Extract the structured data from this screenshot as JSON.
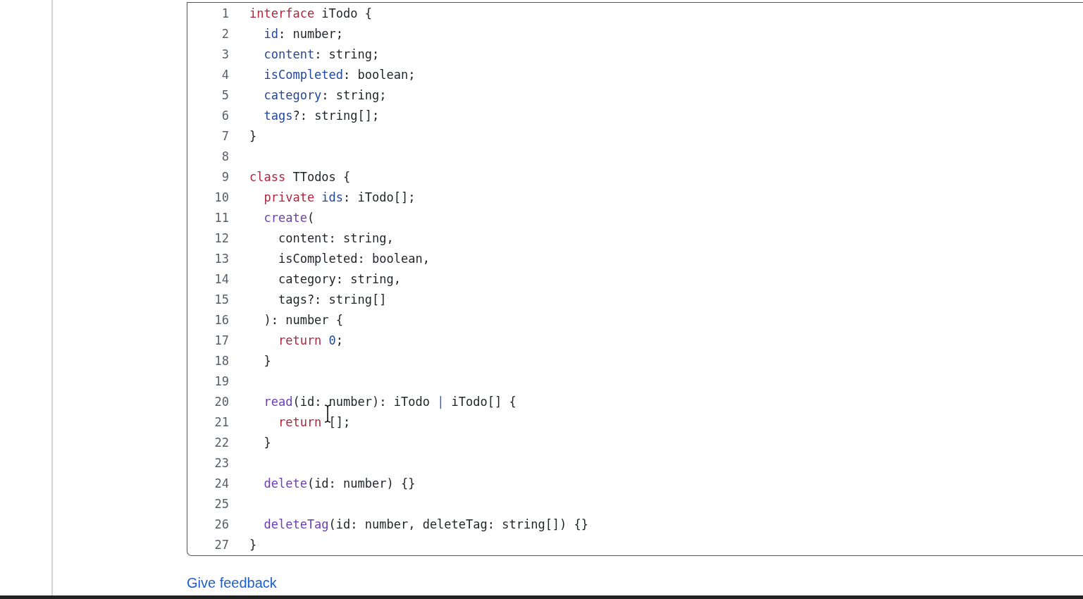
{
  "code_block": {
    "lines": [
      {
        "number": "1",
        "tokens": [
          {
            "kind": "keyword",
            "text": "interface"
          },
          {
            "kind": "plain",
            "text": " iTodo {"
          }
        ]
      },
      {
        "number": "2",
        "tokens": [
          {
            "kind": "property",
            "text": "  id"
          },
          {
            "kind": "plain",
            "text": ": number;"
          }
        ]
      },
      {
        "number": "3",
        "tokens": [
          {
            "kind": "property",
            "text": "  content"
          },
          {
            "kind": "plain",
            "text": ": string;"
          }
        ]
      },
      {
        "number": "4",
        "tokens": [
          {
            "kind": "property",
            "text": "  isCompleted"
          },
          {
            "kind": "plain",
            "text": ": boolean;"
          }
        ]
      },
      {
        "number": "5",
        "tokens": [
          {
            "kind": "property",
            "text": "  category"
          },
          {
            "kind": "plain",
            "text": ": string;"
          }
        ]
      },
      {
        "number": "6",
        "tokens": [
          {
            "kind": "property",
            "text": "  tags"
          },
          {
            "kind": "plain",
            "text": "?: string[];"
          }
        ]
      },
      {
        "number": "7",
        "tokens": [
          {
            "kind": "plain",
            "text": "}"
          }
        ]
      },
      {
        "number": "8"
      },
      {
        "number": "9",
        "tokens": [
          {
            "kind": "keyword",
            "text": "class"
          },
          {
            "kind": "plain",
            "text": " TTodos {"
          }
        ]
      },
      {
        "number": "10",
        "tokens": [
          {
            "kind": "keyword",
            "text": "  private"
          },
          {
            "kind": "property",
            "text": " ids"
          },
          {
            "kind": "plain",
            "text": ": iTodo[];"
          }
        ]
      },
      {
        "number": "11",
        "tokens": [
          {
            "kind": "function",
            "text": "  create"
          },
          {
            "kind": "plain",
            "text": "("
          }
        ]
      },
      {
        "number": "12",
        "tokens": [
          {
            "kind": "plain",
            "text": "    content: string,"
          }
        ]
      },
      {
        "number": "13",
        "tokens": [
          {
            "kind": "plain",
            "text": "    isCompleted: boolean,"
          }
        ]
      },
      {
        "number": "14",
        "tokens": [
          {
            "kind": "plain",
            "text": "    category: string,"
          }
        ]
      },
      {
        "number": "15",
        "tokens": [
          {
            "kind": "plain",
            "text": "    tags?: string[]"
          }
        ]
      },
      {
        "number": "16",
        "tokens": [
          {
            "kind": "plain",
            "text": "  ): number {"
          }
        ]
      },
      {
        "number": "17",
        "tokens": [
          {
            "kind": "keyword",
            "text": "    return"
          },
          {
            "kind": "number",
            "text": " 0"
          },
          {
            "kind": "plain",
            "text": ";"
          }
        ]
      },
      {
        "number": "18",
        "tokens": [
          {
            "kind": "plain",
            "text": "  }"
          }
        ]
      },
      {
        "number": "19"
      },
      {
        "number": "20",
        "tokens": [
          {
            "kind": "function",
            "text": "  read"
          },
          {
            "kind": "plain",
            "text": "(id: number): iTodo "
          },
          {
            "kind": "operator",
            "text": "|"
          },
          {
            "kind": "plain",
            "text": " iTodo[] {"
          }
        ]
      },
      {
        "number": "21",
        "tokens": [
          {
            "kind": "keyword",
            "text": "    return"
          },
          {
            "kind": "plain",
            "text": " [];"
          }
        ]
      },
      {
        "number": "22",
        "tokens": [
          {
            "kind": "plain",
            "text": "  }"
          }
        ]
      },
      {
        "number": "23"
      },
      {
        "number": "24",
        "tokens": [
          {
            "kind": "function",
            "text": "  delete"
          },
          {
            "kind": "plain",
            "text": "(id: number) {}"
          }
        ]
      },
      {
        "number": "25"
      },
      {
        "number": "26",
        "tokens": [
          {
            "kind": "function",
            "text": "  deleteTag"
          },
          {
            "kind": "plain",
            "text": "(id: number, deleteTag: string[]) {}"
          }
        ]
      },
      {
        "number": "27",
        "tokens": [
          {
            "kind": "plain",
            "text": "}"
          }
        ]
      }
    ]
  },
  "feedback_link": "Give feedback"
}
